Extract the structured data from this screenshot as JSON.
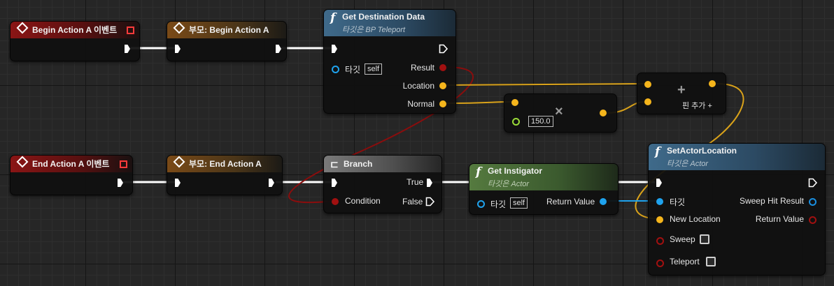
{
  "nodes": {
    "begin_event": {
      "title": "Begin Action A 이벤트"
    },
    "begin_parent": {
      "title": "부모: Begin Action A"
    },
    "get_dest": {
      "title": "Get Destination Data",
      "target": "타깃은 BP Teleport",
      "target_label": "타깃",
      "self": "self",
      "outputs": [
        "Result",
        "Location",
        "Normal"
      ]
    },
    "multiply": {
      "value": "150.0",
      "symbol": "×"
    },
    "add": {
      "symbol": "+",
      "add_pin": "핀 추가 +"
    },
    "end_event": {
      "title": "End Action A 이벤트"
    },
    "end_parent": {
      "title": "부모: End Action A"
    },
    "branch": {
      "title": "Branch",
      "condition": "Condition",
      "true": "True",
      "false": "False"
    },
    "get_instigator": {
      "title": "Get Instigator",
      "target": "타깃은 Actor",
      "target_label": "타깃",
      "self": "self",
      "return": "Return Value"
    },
    "set_actor_location": {
      "title": "SetActorLocation",
      "target": "타깃은 Actor",
      "inputs": [
        "타깃",
        "New Location",
        "Sweep",
        "Teleport"
      ],
      "outputs": [
        "Sweep Hit Result",
        "Return Value"
      ]
    }
  },
  "colors": {
    "exec": "#ffffff",
    "vector": "#f5b51c",
    "object": "#1fa3ee",
    "bool": "#a11010",
    "float": "#9adb38",
    "struct": "#1a8fe0"
  },
  "icons": [
    "function-icon",
    "event-diamond-icon",
    "branch-icon",
    "multiply-icon",
    "add-icon",
    "checkbox-icon"
  ]
}
